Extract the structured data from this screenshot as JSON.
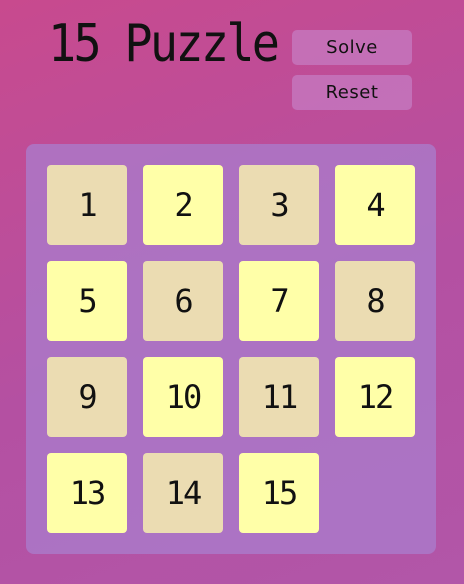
{
  "title": "15 Puzzle",
  "buttons": {
    "solve_label": "Solve",
    "reset_label": "Reset"
  },
  "board": {
    "size": 4,
    "tiles": [
      {
        "label": "1",
        "color": "beige"
      },
      {
        "label": "2",
        "color": "yellow"
      },
      {
        "label": "3",
        "color": "beige"
      },
      {
        "label": "4",
        "color": "yellow"
      },
      {
        "label": "5",
        "color": "yellow"
      },
      {
        "label": "6",
        "color": "beige"
      },
      {
        "label": "7",
        "color": "yellow"
      },
      {
        "label": "8",
        "color": "beige"
      },
      {
        "label": "9",
        "color": "beige"
      },
      {
        "label": "10",
        "color": "yellow"
      },
      {
        "label": "11",
        "color": "beige"
      },
      {
        "label": "12",
        "color": "yellow"
      },
      {
        "label": "13",
        "color": "yellow"
      },
      {
        "label": "14",
        "color": "beige"
      },
      {
        "label": "15",
        "color": "yellow"
      },
      null
    ]
  },
  "colors": {
    "background": "#c84a8e",
    "board": "#aa7dcd",
    "tile_beige": "#ebdcb2",
    "tile_yellow": "#ffffa8",
    "button": "#c88cd2"
  }
}
